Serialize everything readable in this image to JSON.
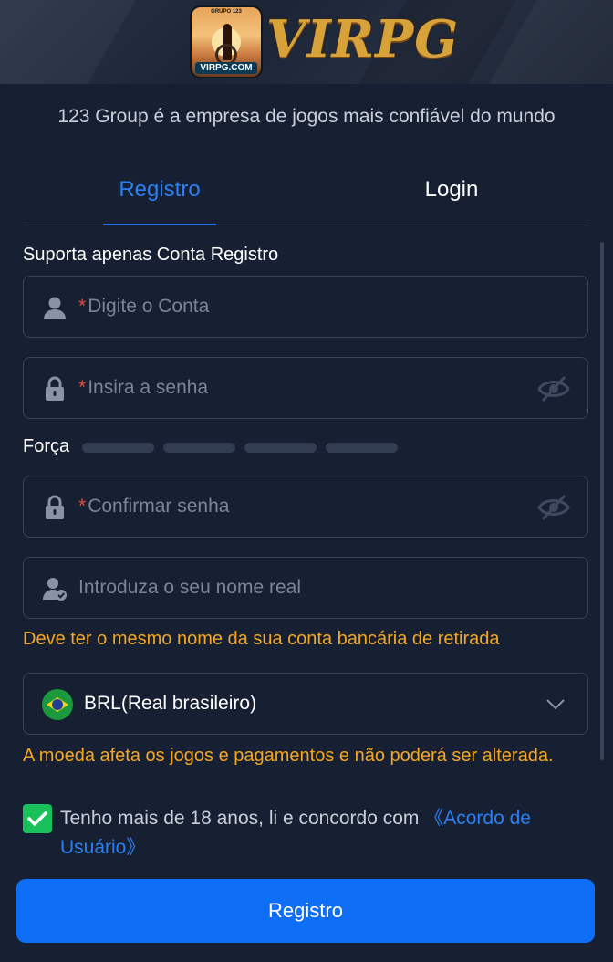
{
  "header": {
    "logo_top_text": "GRUPO 123",
    "logo_site_text": "VIRPG.COM",
    "brand_name": "VIRPG"
  },
  "tagline": "123 Group é a empresa de jogos mais confiável do mundo",
  "tabs": [
    {
      "label": "Registro",
      "active": true
    },
    {
      "label": "Login",
      "active": false
    }
  ],
  "form": {
    "section_label": "Suporta apenas Conta Registro",
    "account_placeholder": "Digite o Conta",
    "password_placeholder": "Insira a senha",
    "strength_label": "Força",
    "strength_level": 0,
    "confirm_placeholder": "Confirmar senha",
    "realname_placeholder": "Introduza o seu nome real",
    "realname_hint": "Deve ter o mesmo nome da sua conta bancária de retirada",
    "currency_value": "BRL(Real brasileiro)",
    "currency_hint": "A moeda afeta os jogos e pagamentos e não poderá ser alterada.",
    "agree_text": "Tenho mais de 18 anos, li e concordo com ",
    "agree_link": "《Acordo de Usuário》",
    "agree_checked": true,
    "required_mark": "*",
    "submit_label": "Registro"
  },
  "icons": {
    "account": "user-icon",
    "password": "lock-icon",
    "toggle_visibility": "eye-off-icon",
    "realname": "user-check-icon",
    "currency": "brazil-flag-icon",
    "dropdown": "chevron-down-icon",
    "checkbox": "check-icon"
  },
  "colors": {
    "background": "#162032",
    "accent": "#2b7ff2",
    "warning": "#f5a623",
    "required": "#e74c3c",
    "checkbox": "#19c15a",
    "button": "#0f6ef6"
  }
}
